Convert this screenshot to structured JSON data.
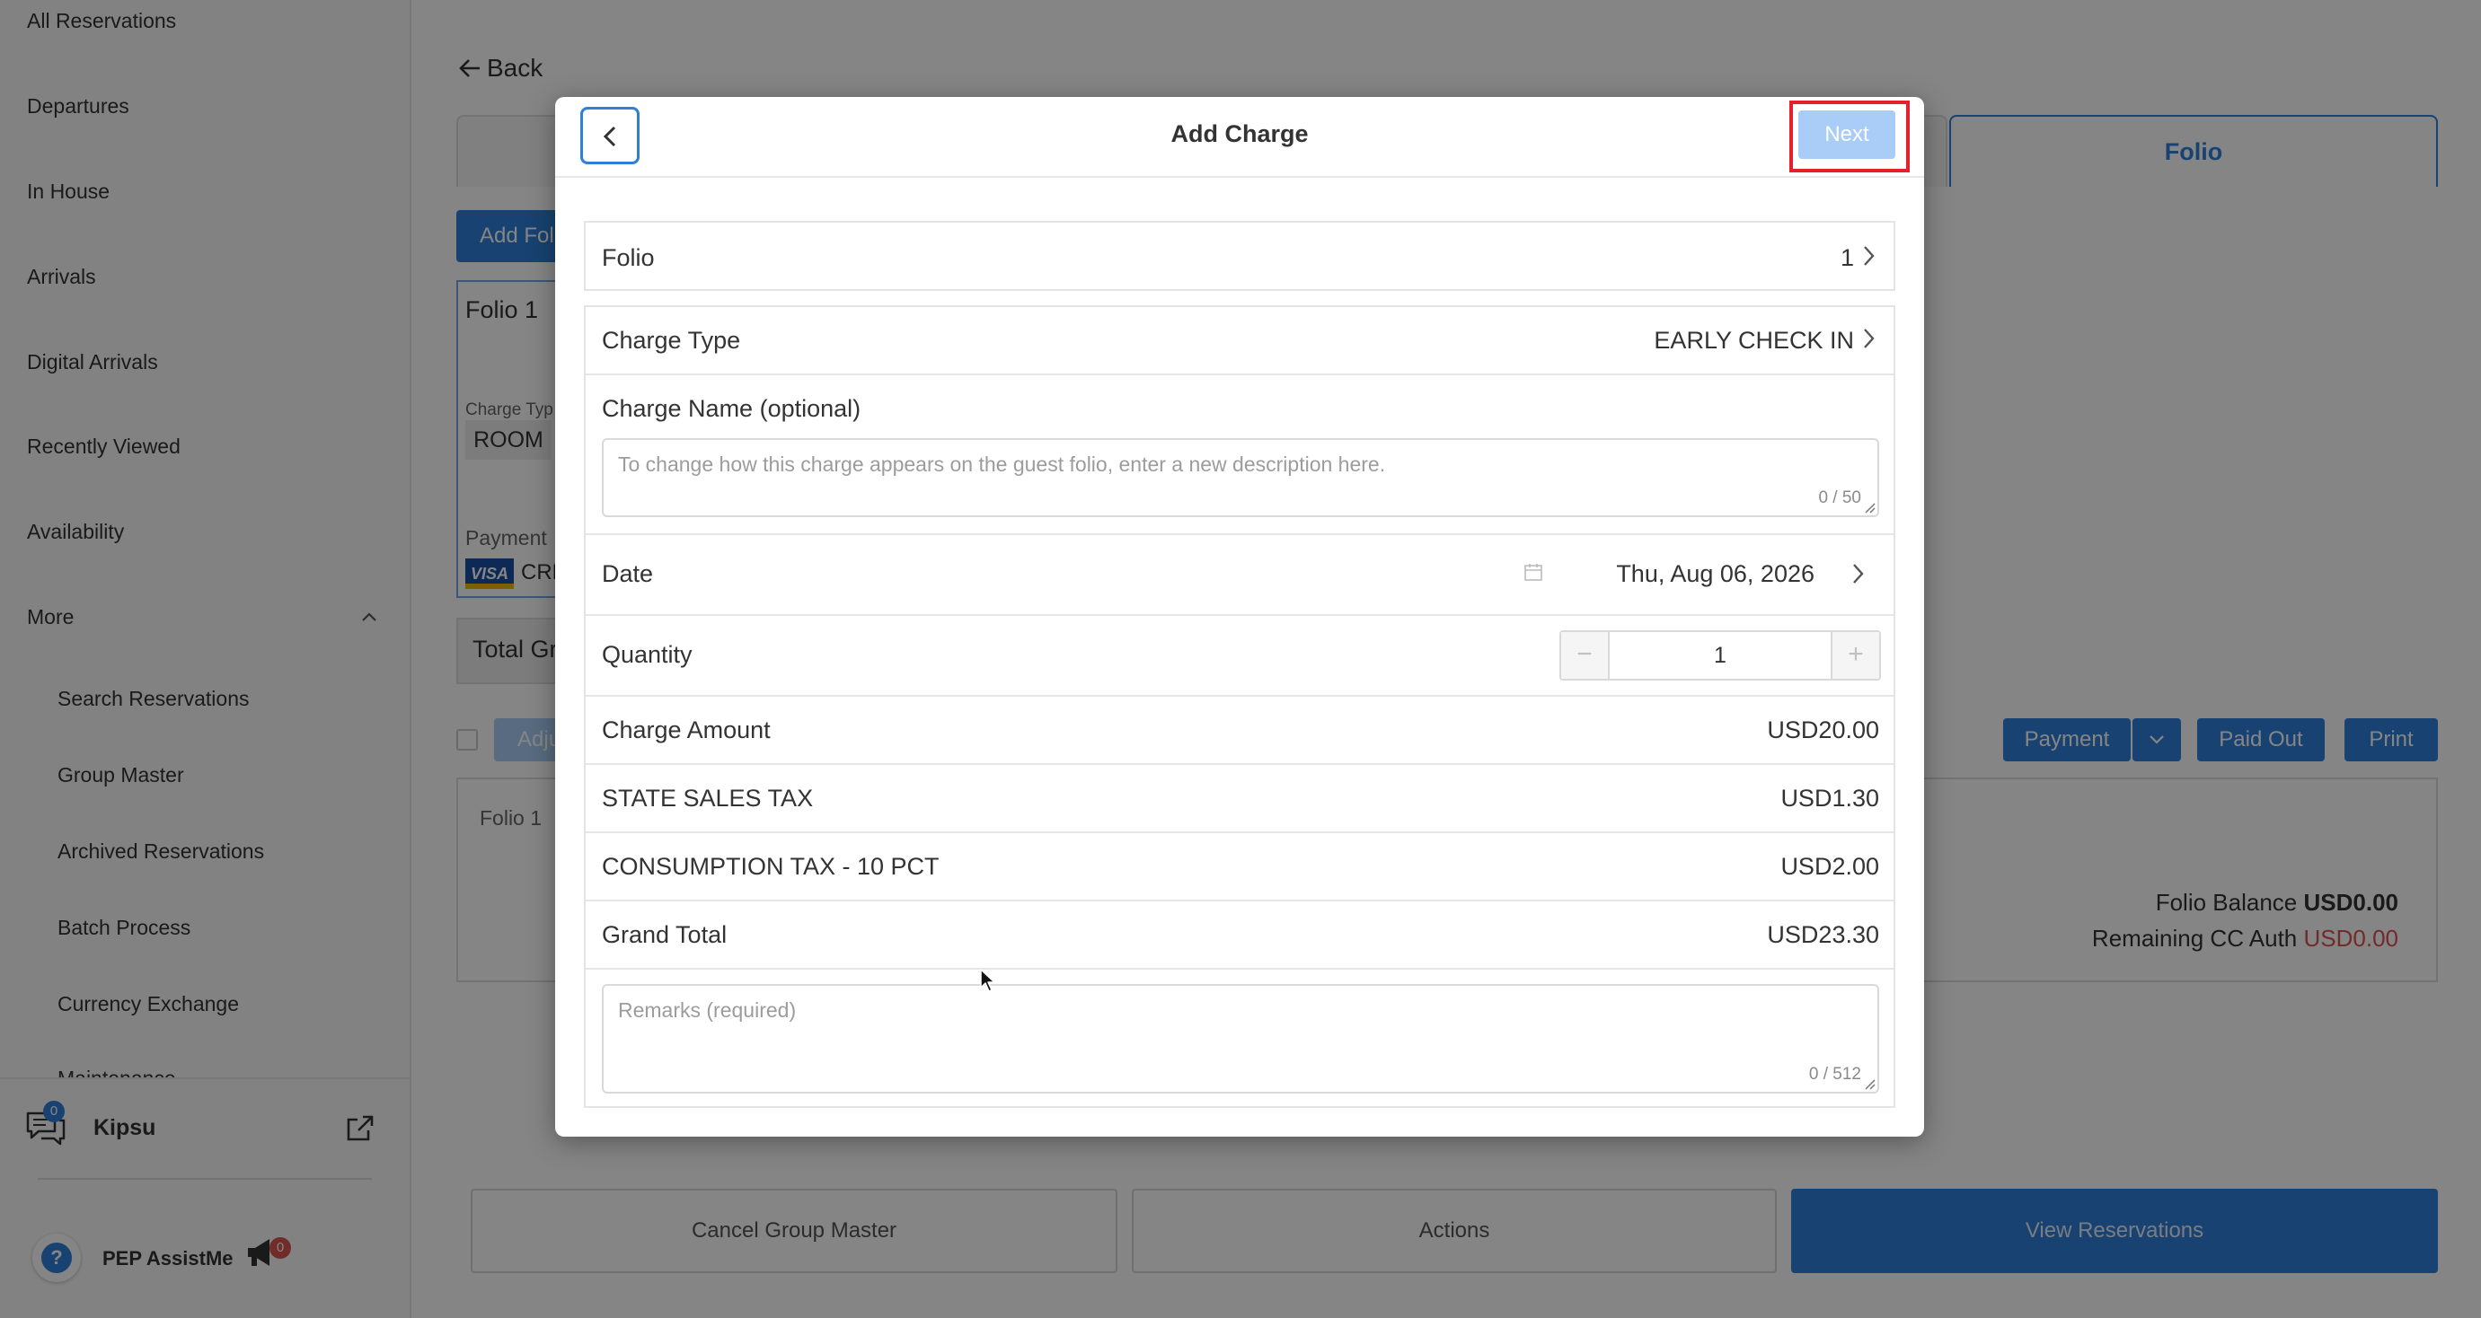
{
  "sidebar": {
    "items": [
      {
        "label": "All Reservations"
      },
      {
        "label": "Departures"
      },
      {
        "label": "In House"
      },
      {
        "label": "Arrivals"
      },
      {
        "label": "Digital Arrivals"
      },
      {
        "label": "Recently Viewed"
      },
      {
        "label": "Availability"
      },
      {
        "label": "More"
      }
    ],
    "more_items": [
      {
        "label": "Search Reservations"
      },
      {
        "label": "Group Master"
      },
      {
        "label": "Archived Reservations"
      },
      {
        "label": "Batch Process"
      },
      {
        "label": "Currency Exchange"
      },
      {
        "label": "Maintenance"
      }
    ],
    "kipsu": {
      "label": "Kipsu",
      "badge": "0"
    },
    "pep": {
      "label": "PEP AssistMe",
      "badge": "0"
    }
  },
  "background": {
    "back_label": "Back",
    "folio_tab": "Folio",
    "add_folio": "Add Foli",
    "folio_card_title": "Folio 1",
    "charge_type_label": "Charge Typ",
    "room_chip": "ROOM",
    "payment_label": "Payment",
    "card_brand": "VISA",
    "card_text": "CRE",
    "total_label": "Total Gr",
    "adjust_label": "Adju",
    "payment_button": "Payment",
    "paid_out_button": "Paid Out",
    "print_button": "Print",
    "panel_folio": "Folio 1",
    "folio_balance_label": "Folio Balance",
    "folio_balance_value": "USD0.00",
    "remaining_cc_label": "Remaining CC Auth",
    "remaining_cc_value": "USD0.00",
    "cancel_group_master": "Cancel Group Master",
    "actions": "Actions",
    "view_reservations": "View Reservations"
  },
  "modal": {
    "title": "Add Charge",
    "next_label": "Next",
    "folio": {
      "label": "Folio",
      "value": "1"
    },
    "charge_type": {
      "label": "Charge Type",
      "value": "EARLY CHECK IN"
    },
    "charge_name": {
      "label": "Charge Name (optional)",
      "placeholder": "To change how this charge appears on the guest folio, enter a new description here.",
      "counter": "0 / 50"
    },
    "date": {
      "label": "Date",
      "value": "Thu, Aug 06, 2026"
    },
    "quantity": {
      "label": "Quantity",
      "value": "1",
      "minus": "−",
      "plus": "+"
    },
    "charges": [
      {
        "label": "Charge Amount",
        "value": "USD20.00"
      },
      {
        "label": "STATE SALES TAX",
        "value": "USD1.30"
      },
      {
        "label": "CONSUMPTION TAX - 10 PCT",
        "value": "USD2.00"
      },
      {
        "label": "Grand Total",
        "value": "USD23.30"
      }
    ],
    "remarks": {
      "placeholder": "Remarks (required)",
      "counter": "0 / 512"
    }
  },
  "colors": {
    "accent": "#2f7fd8",
    "highlight": "#e5202b",
    "negative": "#d9534f"
  }
}
